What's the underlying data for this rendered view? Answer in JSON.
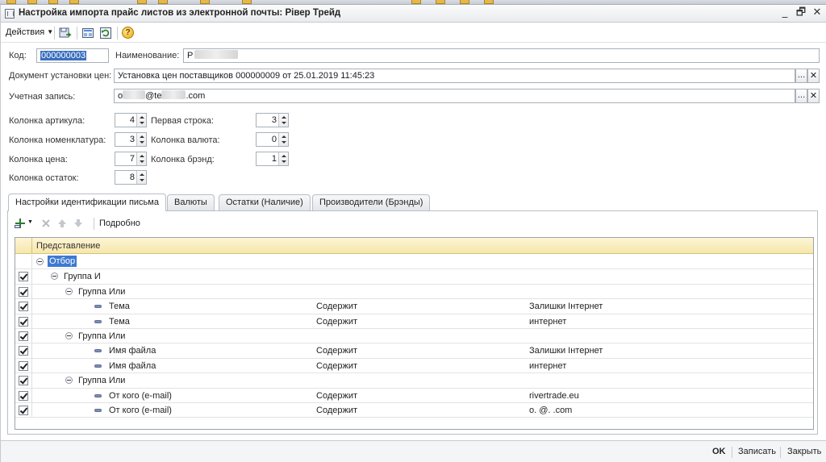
{
  "window": {
    "title": "Настройка импорта прайс листов из электронной почты: Рівер Трейд",
    "minimize_glyph": "_",
    "restore_glyph": "🗗",
    "close_glyph": "✕"
  },
  "toolbar": {
    "actions_label": "Действия",
    "help_glyph": "?"
  },
  "form": {
    "code_label": "Код:",
    "code_value": "000000003",
    "name_label": "Наименование:",
    "name_value": "Р",
    "doc_label": "Документ установки цен:",
    "doc_value": "Установка цен поставщиков 000000009 от 25.01.2019 11:45:23",
    "account_label": "Учетная запись:",
    "account_value_start": "o",
    "account_value_mid": "@te",
    "account_value_end": ".com",
    "select_glyph": "...",
    "clear_glyph": "✕",
    "article_col_label": "Колонка артикула:",
    "article_col_value": "4",
    "first_row_label": "Первая строка:",
    "first_row_value": "3",
    "nomenclature_col_label": "Колонка номенклатура:",
    "nomenclature_col_value": "3",
    "currency_col_label": "Колонка валюта:",
    "currency_col_value": "0",
    "price_col_label": "Колонка цена:",
    "price_col_value": "7",
    "brand_col_label": "Колонка брэнд:",
    "brand_col_value": "1",
    "stock_col_label": "Колонка остаток:",
    "stock_col_value": "8"
  },
  "tabs": [
    {
      "label": "Настройки идентификации письма"
    },
    {
      "label": "Валюты"
    },
    {
      "label": "Остатки (Наличие)"
    },
    {
      "label": "Производители (Брэнды)"
    }
  ],
  "filter": {
    "detail_label": "Подробно",
    "column_header": "Представление",
    "root_label": "Отбор",
    "rows": [
      {
        "level": 1,
        "type": "group",
        "field": "Группа И",
        "condition": "",
        "value": ""
      },
      {
        "level": 2,
        "type": "group",
        "field": "Группа Или",
        "condition": "",
        "value": ""
      },
      {
        "level": 3,
        "type": "item",
        "field": "Тема",
        "condition": "Содержит",
        "value": "Залишки Інтернет"
      },
      {
        "level": 3,
        "type": "item",
        "field": "Тема",
        "condition": "Содержит",
        "value": "интернет"
      },
      {
        "level": 2,
        "type": "group",
        "field": "Группа Или",
        "condition": "",
        "value": ""
      },
      {
        "level": 3,
        "type": "item",
        "field": "Имя файла",
        "condition": "Содержит",
        "value": "Залишки Інтернет"
      },
      {
        "level": 3,
        "type": "item",
        "field": "Имя файла",
        "condition": "Содержит",
        "value": "интернет"
      },
      {
        "level": 2,
        "type": "group",
        "field": "Группа Или",
        "condition": "",
        "value": ""
      },
      {
        "level": 3,
        "type": "item",
        "field": "От кого (e-mail)",
        "condition": "Содержит",
        "value": "rivertrade.eu"
      },
      {
        "level": 3,
        "type": "item",
        "field": "От кого (e-mail)",
        "condition": "Содержит",
        "value": "o.      @.     .com"
      }
    ]
  },
  "footer": {
    "ok_label": "OK",
    "save_label": "Записать",
    "close_label": "Закрыть"
  }
}
